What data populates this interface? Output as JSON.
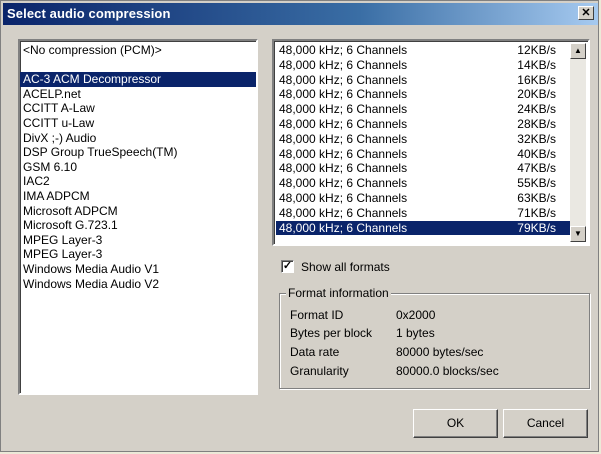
{
  "window": {
    "title": "Select audio compression",
    "close_glyph": "✕"
  },
  "codecs": [
    "<No compression (PCM)>",
    "AC-3 ACM Decompressor",
    "ACELP.net",
    "CCITT A-Law",
    "CCITT u-Law",
    "DivX ;-) Audio",
    "DSP Group TrueSpeech(TM)",
    "GSM 6.10",
    "IAC2",
    "IMA ADPCM",
    "Microsoft ADPCM",
    "Microsoft G.723.1",
    "MPEG Layer-3",
    "MPEG Layer-3",
    "Windows Media Audio V1",
    "Windows Media Audio V2"
  ],
  "selected_codec": "AC-3 ACM Decompressor",
  "formats": [
    {
      "format": "48,000 kHz; 6 Channels",
      "rate": "12KB/s"
    },
    {
      "format": "48,000 kHz; 6 Channels",
      "rate": "14KB/s"
    },
    {
      "format": "48,000 kHz; 6 Channels",
      "rate": "16KB/s"
    },
    {
      "format": "48,000 kHz; 6 Channels",
      "rate": "20KB/s"
    },
    {
      "format": "48,000 kHz; 6 Channels",
      "rate": "24KB/s"
    },
    {
      "format": "48,000 kHz; 6 Channels",
      "rate": "28KB/s"
    },
    {
      "format": "48,000 kHz; 6 Channels",
      "rate": "32KB/s"
    },
    {
      "format": "48,000 kHz; 6 Channels",
      "rate": "40KB/s"
    },
    {
      "format": "48,000 kHz; 6 Channels",
      "rate": "47KB/s"
    },
    {
      "format": "48,000 kHz; 6 Channels",
      "rate": "55KB/s"
    },
    {
      "format": "48,000 kHz; 6 Channels",
      "rate": "63KB/s"
    },
    {
      "format": "48,000 kHz; 6 Channels",
      "rate": "71KB/s"
    },
    {
      "format": "48,000 kHz; 6 Channels",
      "rate": "79KB/s"
    }
  ],
  "selected_format_rate": "79KB/s",
  "scrollbar": {
    "up_icon": "triangle-up-icon",
    "down_icon": "triangle-down-icon",
    "up_glyph": "▲",
    "down_glyph": "▼"
  },
  "show_all_formats": {
    "label": "Show all formats",
    "checked": true,
    "check_glyph": "✓"
  },
  "format_info": {
    "title": "Format information",
    "rows": [
      {
        "label": "Format ID",
        "value": "0x2000"
      },
      {
        "label": "Bytes per block",
        "value": "1 bytes"
      },
      {
        "label": "Data rate",
        "value": "80000 bytes/sec"
      },
      {
        "label": "Granularity",
        "value": "80000.0 blocks/sec"
      }
    ]
  },
  "buttons": {
    "ok": "OK",
    "cancel": "Cancel"
  },
  "colors": {
    "selection": "#0a246a",
    "face": "#d4d0c8",
    "title_start": "#0a246a",
    "title_end": "#a6caf0"
  }
}
